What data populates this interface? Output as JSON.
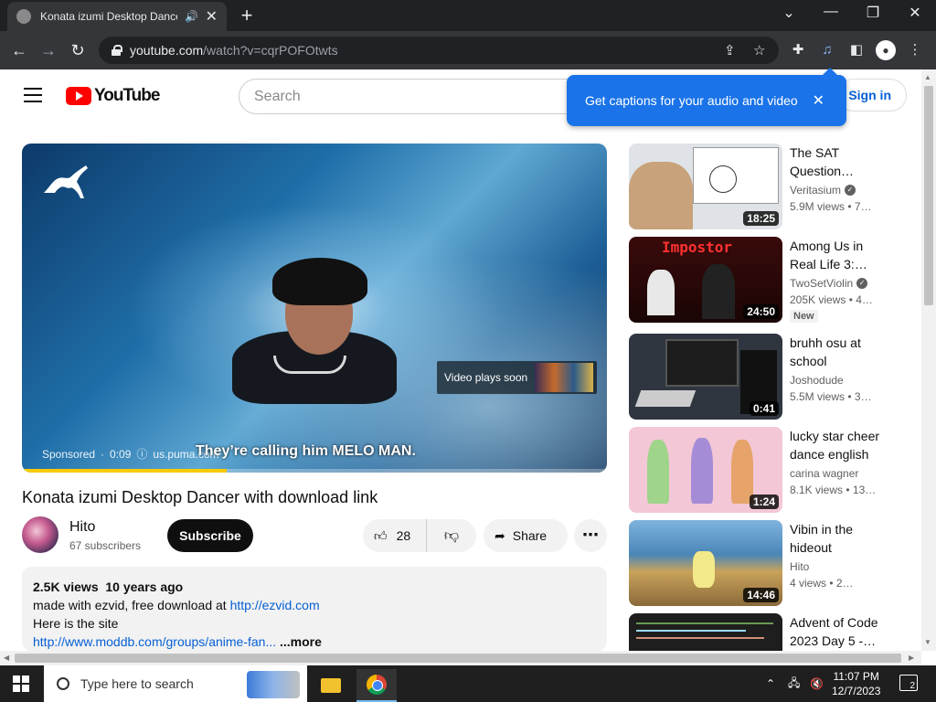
{
  "browser": {
    "tab_title": "Konata izumi Desktop Dancer with download link",
    "tab_close_icon": "✕",
    "new_tab_icon": "+",
    "url_host": "youtube.com",
    "url_path": "/watch?v=cqrPOFOtwts",
    "window_controls": [
      "⌄",
      "—",
      "❐",
      "✕"
    ]
  },
  "youtube": {
    "logo_text": "YouTube",
    "search_placeholder": "Search",
    "sign_in_label": "Sign in",
    "captions_popup": "Get captions for your audio and video",
    "captions_close": "✕"
  },
  "player": {
    "video_plays_soon": "Video plays soon",
    "sponsored": "Sponsored",
    "ad_time": "0:09",
    "ad_url": "us.puma.com",
    "caption_text": "They’re calling him MELO MAN.",
    "progress": 0.35
  },
  "video": {
    "title": "Konata izumi Desktop Dancer with download link",
    "channel": "Hito",
    "subscribers": "67 subscribers",
    "subscribe_label": "Subscribe",
    "likes": "28",
    "share_label": "Share",
    "more_label": "⋯",
    "views": "2.5K views",
    "posted": "10 years ago",
    "desc_line1": "made with ezvid, free download at ",
    "desc_link1": "http://ezvid.com",
    "desc_line2": "Here is the site",
    "desc_link2": "http://www.moddb.com/groups/anime-fan...",
    "desc_more": "...more"
  },
  "sidebar": [
    {
      "title": "The SAT Question…",
      "channel": "Veritasium",
      "verified": true,
      "meta": "5.9M views • 7…",
      "duration": "18:25",
      "thumb_color": "#dfe3e8"
    },
    {
      "title": "Among Us in Real Life 3:…",
      "channel": "TwoSetViolin",
      "verified": true,
      "meta": "205K views • 4…",
      "duration": "24:50",
      "badge": "New",
      "thumb_color": "#3a0b0b",
      "impostor_text": "Impostor"
    },
    {
      "title": "bruhh osu at school",
      "channel": "Joshodude",
      "verified": false,
      "meta": "5.5M views • 3…",
      "duration": "0:41",
      "thumb_color": "#2f3640"
    },
    {
      "title": "lucky star cheer dance english",
      "channel": "carina wagner",
      "verified": false,
      "meta": "8.1K views • 13…",
      "duration": "1:24",
      "thumb_color": "#f3c7d6"
    },
    {
      "title": "Vibin in the hideout",
      "channel": "Hito",
      "verified": false,
      "meta": "4 views • 2…",
      "duration": "14:46",
      "thumb_color": "#4a86b8"
    },
    {
      "title": "Advent of Code 2023 Day 5 -…",
      "channel": "",
      "verified": false,
      "meta": "",
      "duration": "",
      "thumb_color": "#1e1e1e"
    }
  ],
  "taskbar": {
    "search_placeholder": "Type here to search",
    "time": "11:07 PM",
    "date": "12/7/2023",
    "notification_count": "2"
  }
}
